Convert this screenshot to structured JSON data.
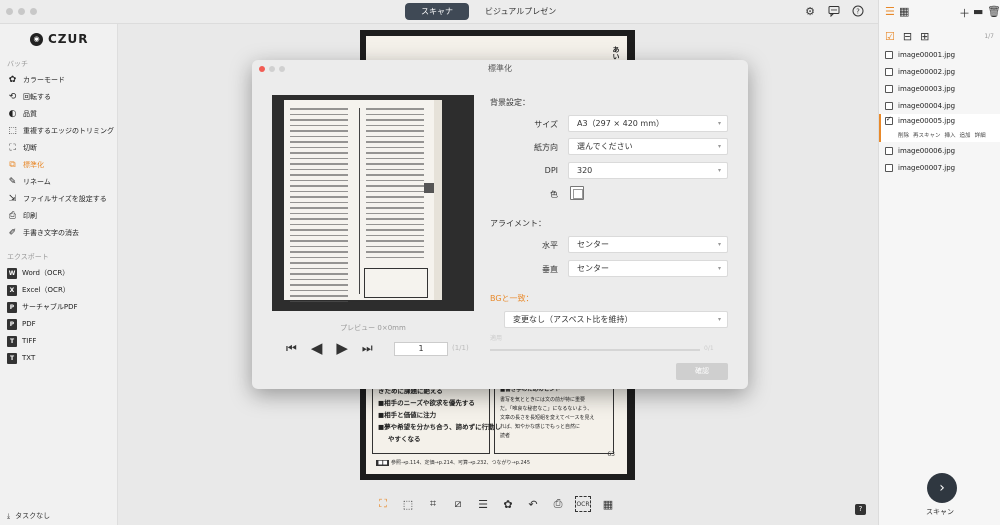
{
  "top": {
    "tabs": [
      "スキャナ",
      "ビジュアルプレゼン"
    ]
  },
  "sidebar": {
    "logo": "CZUR",
    "batch_label": "バッチ",
    "items": [
      "カラーモード",
      "回転する",
      "品質",
      "重複するエッジのトリミング",
      "切断",
      "標準化",
      "リネーム",
      "ファイルサイズを設定する",
      "印刷",
      "手書き文字の消去"
    ],
    "export_label": "エクスポート",
    "exports": [
      {
        "icon": "W",
        "label": "Word（OCR）"
      },
      {
        "icon": "X",
        "label": "Excel（OCR）"
      },
      {
        "icon": "P",
        "label": "サーチャブルPDF"
      },
      {
        "icon": "P",
        "label": "PDF"
      },
      {
        "icon": "T",
        "label": "TIFF"
      },
      {
        "icon": "T",
        "label": "TXT"
      }
    ],
    "task": "タスクなし"
  },
  "book": {
    "lines": [
      "きために課題に絶える",
      "■相手のニーズや欲求を優先する",
      "■相手と価値に注力",
      "■夢や希望を分かち合う、諦めずに行動し",
      "やすくなる"
    ],
    "box_title": "■書き手のためのヒント",
    "box_lines": [
      "書写を気とときには文の前が特に重要",
      "だ。「唯哀な秘密なこ」になるないよう、",
      "文章の長さを長短組を変えてペースを見え",
      "れば、知やかな感じでもっと自然に",
      "読者"
    ],
    "footer": "参照→p.114、定価→p.214、可算→p.232、つながり→p.245",
    "page_no": "63",
    "corner": "あい"
  },
  "rpanel": {
    "count": "1/7",
    "files": [
      "image00001.jpg",
      "image00002.jpg",
      "image00003.jpg",
      "image00004.jpg",
      "image00005.jpg",
      "image00006.jpg",
      "image00007.jpg"
    ],
    "active_actions": [
      "削除",
      "再スキャン",
      "挿入",
      "追加",
      "詳細"
    ],
    "scan_label": "スキャン"
  },
  "modal": {
    "title": "標準化",
    "preview_label": "プレビュー 0×0mm",
    "page_input": "1",
    "page_count": "(1/1)",
    "background_heading": "背景設定：",
    "size_label": "サイズ",
    "size_value": "A3（297 × 420 mm）",
    "orientation_label": "紙方向",
    "orientation_value": "選んでください",
    "dpi_label": "DPI",
    "dpi_value": "320",
    "color_label": "色",
    "align_heading": "アライメント：",
    "horizontal_label": "水平",
    "horizontal_value": "センター",
    "vertical_label": "垂直",
    "vertical_value": "センター",
    "bg_match_heading": "BGと一致：",
    "bg_match_value": "変更なし（アスペスト比を維持）",
    "threshold_label": "適用",
    "slider_value": "0/1",
    "confirm": "確認"
  },
  "colors": {
    "accent": "#e8892a",
    "dark": "#3f4955"
  }
}
